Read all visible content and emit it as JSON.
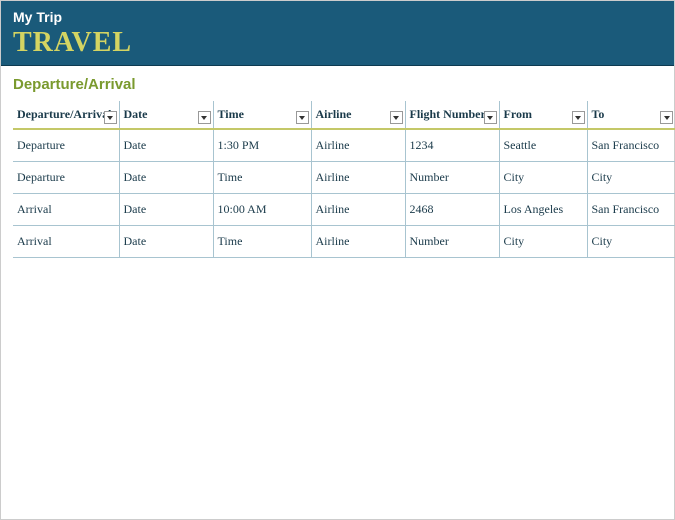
{
  "header": {
    "subtitle": "My Trip",
    "title": "TRAVEL"
  },
  "section_title": "Departure/Arrival",
  "columns": [
    "Departure/Arrival",
    "Date",
    "Time",
    "Airline",
    "Flight Number",
    "From",
    "To"
  ],
  "rows": [
    [
      "Departure",
      "Date",
      "1:30 PM",
      "Airline",
      "1234",
      "Seattle",
      "San Francisco"
    ],
    [
      "Departure",
      "Date",
      "Time",
      "Airline",
      "Number",
      "City",
      "City"
    ],
    [
      "Arrival",
      "Date",
      "10:00 AM",
      "Airline",
      "2468",
      "Los Angeles",
      "San Francisco"
    ],
    [
      "Arrival",
      "Date",
      "Time",
      "Airline",
      "Number",
      "City",
      "City"
    ]
  ]
}
